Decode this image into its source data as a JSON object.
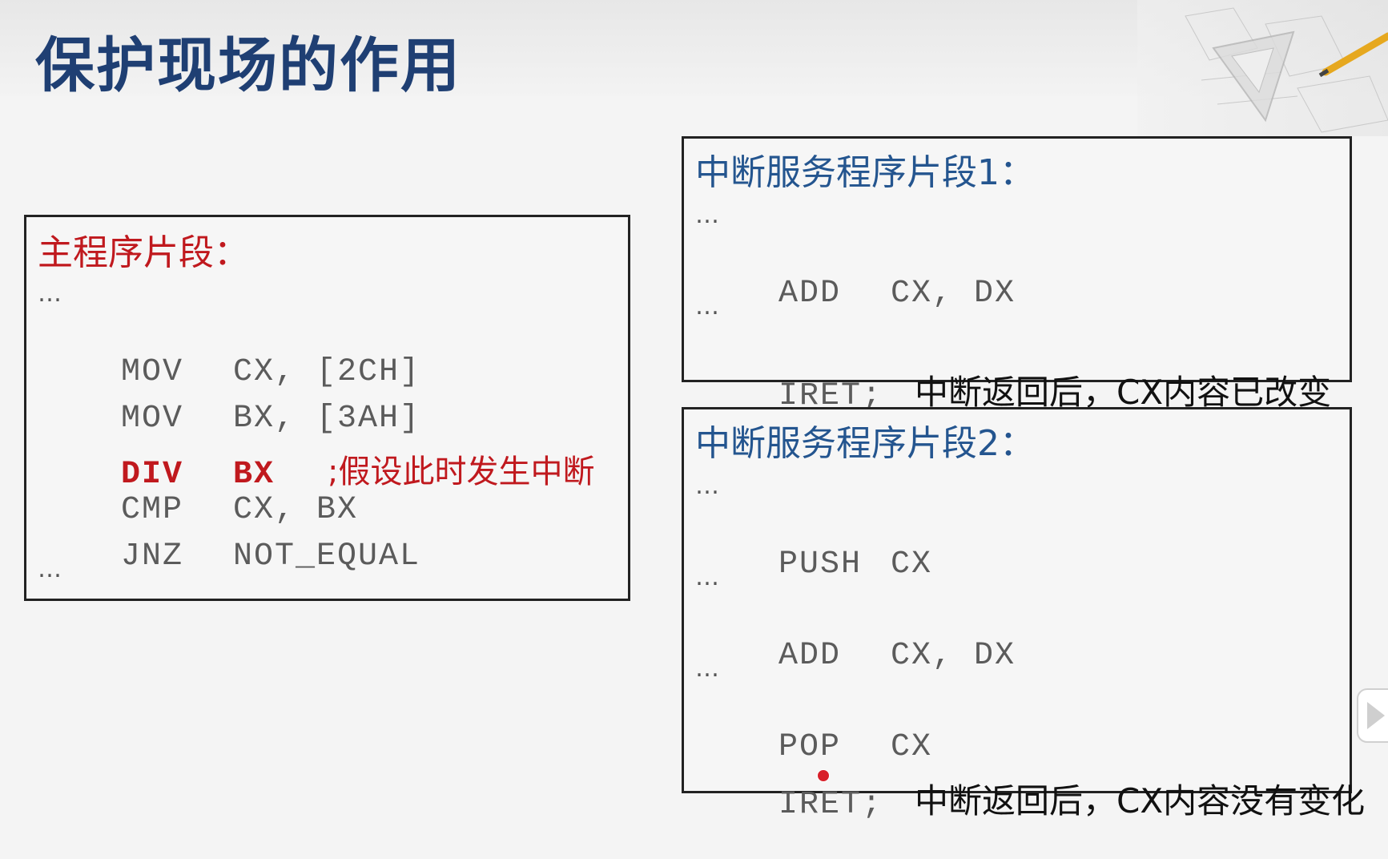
{
  "slide": {
    "title": "保护现场的作用"
  },
  "main_fragment": {
    "heading": "主程序片段：",
    "lines": {
      "l0": "…",
      "l1": {
        "op": "MOV",
        "args": "CX, [2CH]"
      },
      "l2": {
        "op": "MOV",
        "args": "BX, [3AH]"
      },
      "l3": {
        "op": "DIV",
        "args": "BX",
        "comment": ";假设此时发生中断"
      },
      "l4": {
        "op": "CMP",
        "args": "CX, BX"
      },
      "l5": {
        "op": "JNZ",
        "args": "NOT_EQUAL"
      },
      "l6": "…"
    }
  },
  "isr1": {
    "heading": "中断服务程序片段1：",
    "lines": {
      "l0": "…",
      "l1": {
        "op": "ADD",
        "args": "CX, DX"
      },
      "l2": "…",
      "l3": {
        "op": "IRET;",
        "comment": "中断返回后，CX内容已改变"
      }
    }
  },
  "isr2": {
    "heading": "中断服务程序片段2：",
    "lines": {
      "l0": "…",
      "l1": {
        "op": "PUSH",
        "args": "CX"
      },
      "l2": "…",
      "l3": {
        "op": "ADD",
        "args": "CX, DX"
      },
      "l4": "…",
      "l5": {
        "op": "POP",
        "args": "CX"
      },
      "l6": {
        "op": "IRET;",
        "comment": "中断返回后，CX内容没有变化"
      }
    }
  },
  "colors": {
    "title": "#1f3f73",
    "highlight_red": "#c0191e",
    "heading_blue": "#24558f",
    "code_gray": "#5b5b5b"
  },
  "icons": [
    "drafting-tools-decoration",
    "play-icon",
    "cursor-pointer-icon"
  ]
}
